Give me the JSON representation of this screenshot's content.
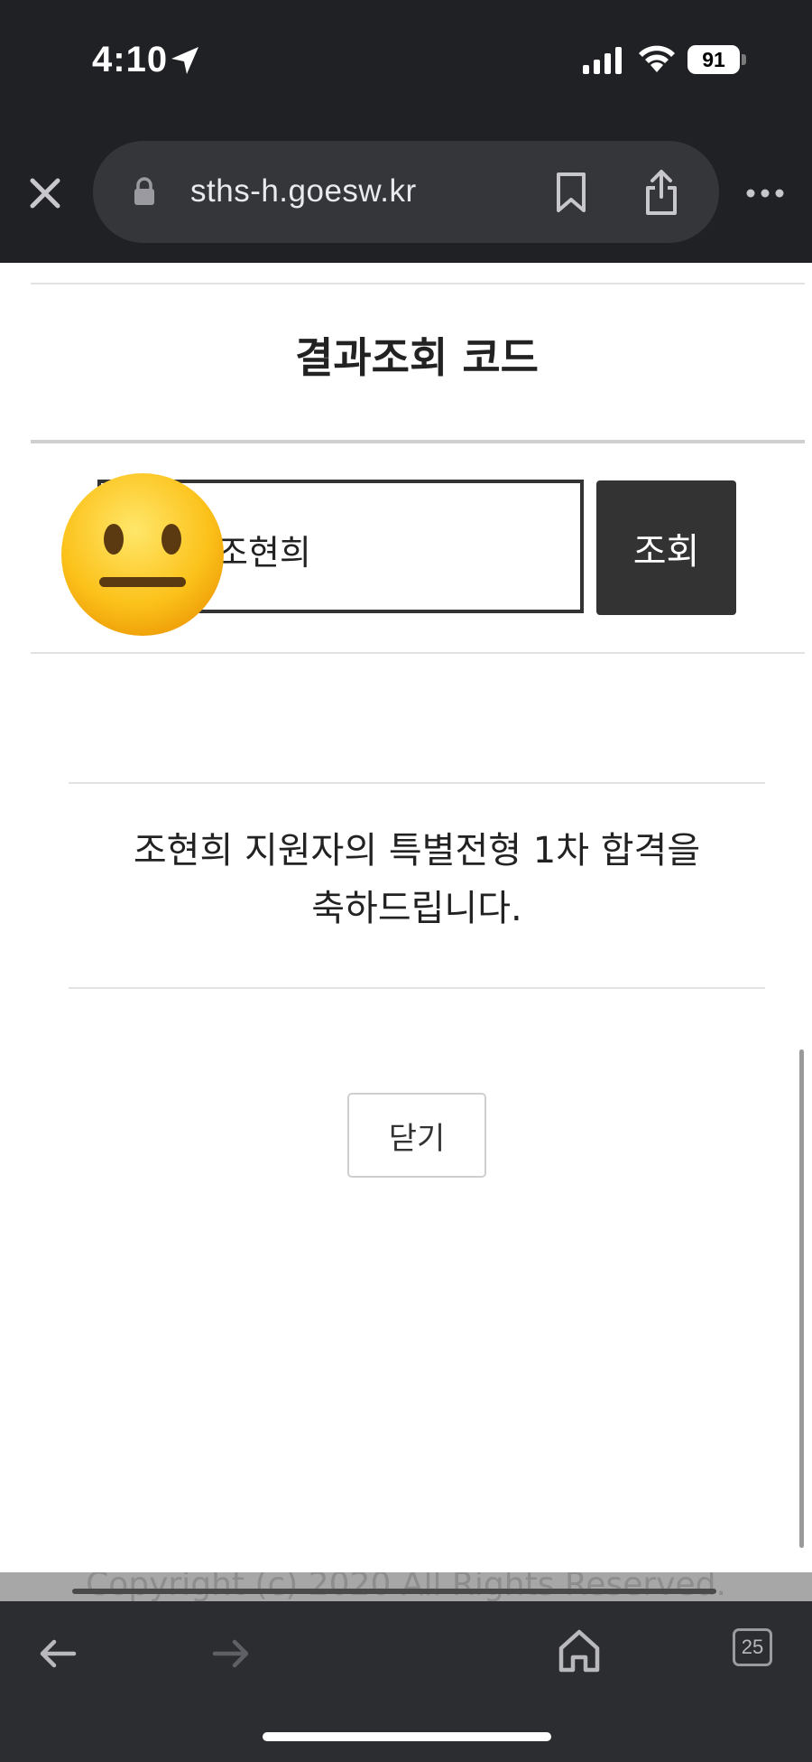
{
  "status_bar": {
    "time": "4:10",
    "battery_level": "91"
  },
  "browser": {
    "url": "sths-h.goesw.kr",
    "tab_count": "25"
  },
  "page": {
    "section_title": "결과조회 코드",
    "search_input_value": "조현희",
    "search_button_label": "조회",
    "result_message": "조현희 지원자의 특별전형 1차 합격을\n축하드립니다.",
    "close_button_label": "닫기",
    "footer_text": "Copyright (c) 2020 All Rights Reserved."
  },
  "colors": {
    "chrome_bg": "#202124",
    "url_pill_bg": "#35363a",
    "toolbar_bg": "#2c2d31",
    "search_button_bg": "#333333",
    "page_bg": "#ffffff"
  },
  "icons": {
    "overlay": "neutral-face-emoji",
    "close": "close-icon",
    "lock": "lock-icon",
    "bookmark": "bookmark-icon",
    "share": "share-icon",
    "more": "more-icon",
    "back": "back-arrow-icon",
    "forward": "forward-arrow-icon",
    "home": "home-icon"
  }
}
